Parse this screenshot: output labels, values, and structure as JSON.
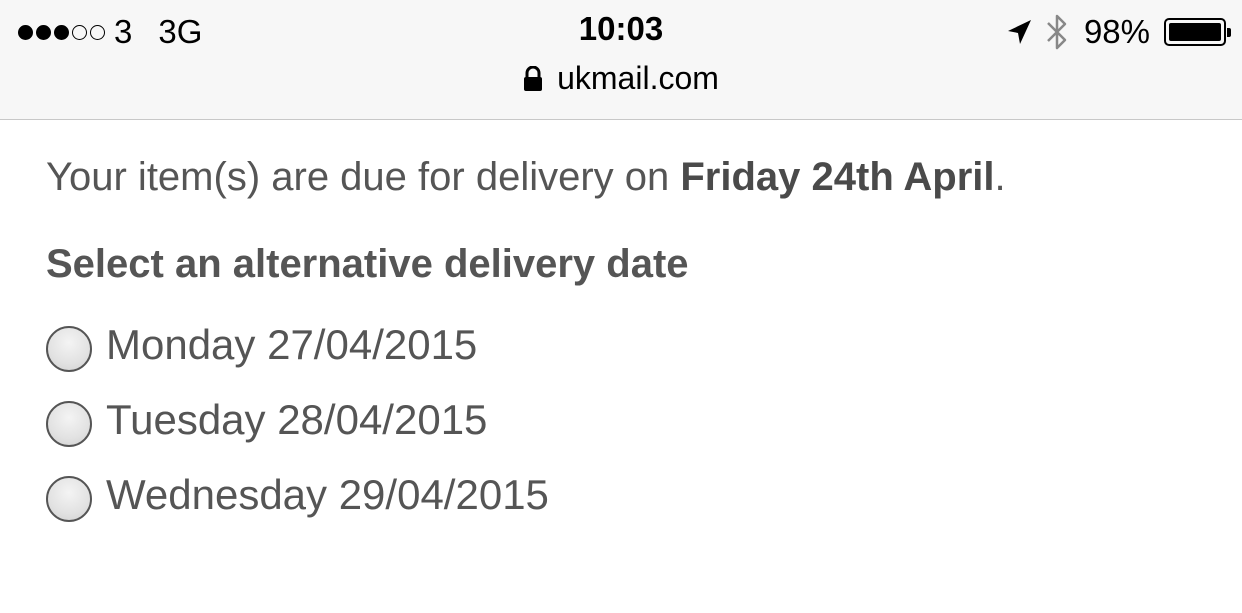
{
  "status_bar": {
    "signal_filled": 3,
    "signal_total": 5,
    "carrier": "3",
    "network": "3G",
    "time": "10:03",
    "battery_percent": "98%",
    "battery_level": 0.98,
    "icons": [
      "location-arrow-icon",
      "bluetooth-icon",
      "battery-icon"
    ]
  },
  "browser": {
    "url": "ukmail.com",
    "secure_icon": "lock-icon"
  },
  "page": {
    "due_prefix": "Your item(s) are due for delivery on ",
    "due_date": "Friday 24th April",
    "due_suffix": ".",
    "alt_heading": "Select an alternative delivery date",
    "options": [
      {
        "label": "Monday 27/04/2015",
        "selected": false
      },
      {
        "label": "Tuesday 28/04/2015",
        "selected": false
      },
      {
        "label": "Wednesday 29/04/2015",
        "selected": false
      }
    ]
  },
  "colors": {
    "text": "#555555",
    "bar_background": "#f7f7f7"
  }
}
